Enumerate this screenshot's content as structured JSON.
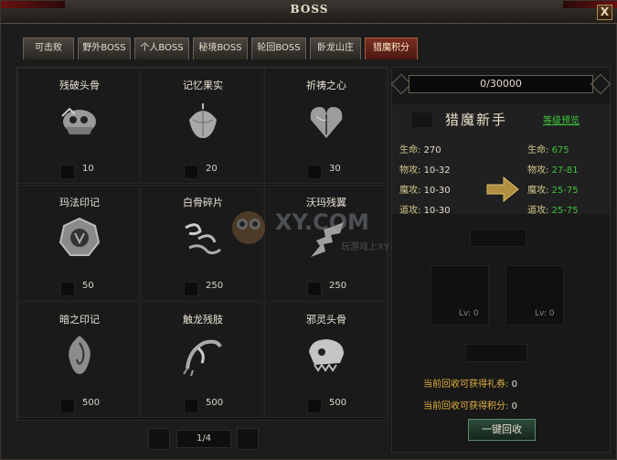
{
  "window": {
    "title": "BOSS",
    "close_label": "X"
  },
  "tabs": [
    {
      "label": "可击败",
      "active": false
    },
    {
      "label": "野外BOSS",
      "active": false
    },
    {
      "label": "个人BOSS",
      "active": false
    },
    {
      "label": "秘境BOSS",
      "active": false
    },
    {
      "label": "轮回BOSS",
      "active": false
    },
    {
      "label": "卧龙山庄",
      "active": false
    },
    {
      "label": "猎魔积分",
      "active": true
    }
  ],
  "items": [
    {
      "name": "残破头骨",
      "value": "10",
      "icon": "skull-icon"
    },
    {
      "name": "记忆果实",
      "value": "20",
      "icon": "fruit-icon"
    },
    {
      "name": "祈祷之心",
      "value": "30",
      "icon": "heart-icon"
    },
    {
      "name": "玛法印记",
      "value": "50",
      "icon": "seal-icon"
    },
    {
      "name": "白骨碎片",
      "value": "250",
      "icon": "bone-shard-icon"
    },
    {
      "name": "沃玛残翼",
      "value": "250",
      "icon": "wing-icon"
    },
    {
      "name": "暗之印记",
      "value": "500",
      "icon": "dark-mark-icon"
    },
    {
      "name": "触龙残肢",
      "value": "500",
      "icon": "claw-icon"
    },
    {
      "name": "邪灵头骨",
      "value": "500",
      "icon": "demon-skull-icon"
    }
  ],
  "pager": {
    "text": "1/4"
  },
  "score": {
    "text": "0/30000"
  },
  "rank": {
    "name": "猎魔新手",
    "preview_link": "等级预览",
    "current": [
      {
        "k": "生命:",
        "v": "270"
      },
      {
        "k": "物攻:",
        "v": "10-32"
      },
      {
        "k": "魔攻:",
        "v": "10-30"
      },
      {
        "k": "道攻:",
        "v": "10-30"
      }
    ],
    "next": [
      {
        "k": "生命:",
        "v": "675"
      },
      {
        "k": "物攻:",
        "v": "27-81"
      },
      {
        "k": "魔攻:",
        "v": "25-75"
      },
      {
        "k": "道攻:",
        "v": "25-75"
      }
    ]
  },
  "slots": [
    {
      "lv": "Lv: 0"
    },
    {
      "lv": "Lv: 0"
    }
  ],
  "recycle": {
    "gift_label": "当前回收可获得礼券:",
    "gift_value": "0",
    "points_label": "当前回收可获得积分:",
    "points_value": "0",
    "button": "一键回收"
  },
  "watermark": {
    "text": "XY.COM",
    "sub": "玩游戏上XY"
  },
  "colors": {
    "accent_green": "#3ec03e",
    "label_gold": "#d0c48a",
    "recycle_gold": "#e0b040"
  }
}
